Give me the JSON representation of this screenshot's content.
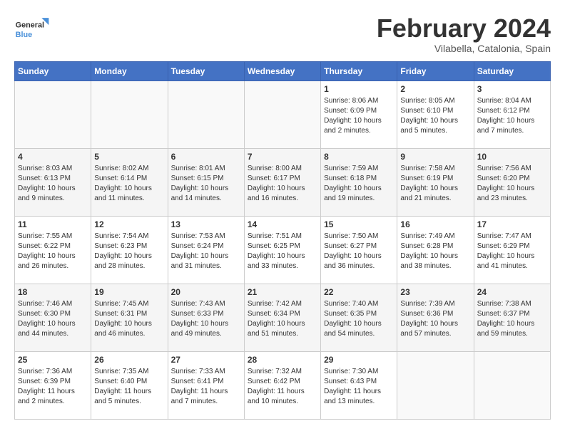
{
  "logo": {
    "text_general": "General",
    "text_blue": "Blue"
  },
  "title": "February 2024",
  "subtitle": "Vilabella, Catalonia, Spain",
  "weekdays": [
    "Sunday",
    "Monday",
    "Tuesday",
    "Wednesday",
    "Thursday",
    "Friday",
    "Saturday"
  ],
  "weeks": [
    [
      {
        "day": "",
        "empty": true
      },
      {
        "day": "",
        "empty": true
      },
      {
        "day": "",
        "empty": true
      },
      {
        "day": "",
        "empty": true
      },
      {
        "day": "1",
        "sunrise": "8:06 AM",
        "sunset": "6:09 PM",
        "daylight": "10 hours and 2 minutes."
      },
      {
        "day": "2",
        "sunrise": "8:05 AM",
        "sunset": "6:10 PM",
        "daylight": "10 hours and 5 minutes."
      },
      {
        "day": "3",
        "sunrise": "8:04 AM",
        "sunset": "6:12 PM",
        "daylight": "10 hours and 7 minutes."
      }
    ],
    [
      {
        "day": "4",
        "sunrise": "8:03 AM",
        "sunset": "6:13 PM",
        "daylight": "10 hours and 9 minutes."
      },
      {
        "day": "5",
        "sunrise": "8:02 AM",
        "sunset": "6:14 PM",
        "daylight": "10 hours and 11 minutes."
      },
      {
        "day": "6",
        "sunrise": "8:01 AM",
        "sunset": "6:15 PM",
        "daylight": "10 hours and 14 minutes."
      },
      {
        "day": "7",
        "sunrise": "8:00 AM",
        "sunset": "6:17 PM",
        "daylight": "10 hours and 16 minutes."
      },
      {
        "day": "8",
        "sunrise": "7:59 AM",
        "sunset": "6:18 PM",
        "daylight": "10 hours and 19 minutes."
      },
      {
        "day": "9",
        "sunrise": "7:58 AM",
        "sunset": "6:19 PM",
        "daylight": "10 hours and 21 minutes."
      },
      {
        "day": "10",
        "sunrise": "7:56 AM",
        "sunset": "6:20 PM",
        "daylight": "10 hours and 23 minutes."
      }
    ],
    [
      {
        "day": "11",
        "sunrise": "7:55 AM",
        "sunset": "6:22 PM",
        "daylight": "10 hours and 26 minutes."
      },
      {
        "day": "12",
        "sunrise": "7:54 AM",
        "sunset": "6:23 PM",
        "daylight": "10 hours and 28 minutes."
      },
      {
        "day": "13",
        "sunrise": "7:53 AM",
        "sunset": "6:24 PM",
        "daylight": "10 hours and 31 minutes."
      },
      {
        "day": "14",
        "sunrise": "7:51 AM",
        "sunset": "6:25 PM",
        "daylight": "10 hours and 33 minutes."
      },
      {
        "day": "15",
        "sunrise": "7:50 AM",
        "sunset": "6:27 PM",
        "daylight": "10 hours and 36 minutes."
      },
      {
        "day": "16",
        "sunrise": "7:49 AM",
        "sunset": "6:28 PM",
        "daylight": "10 hours and 38 minutes."
      },
      {
        "day": "17",
        "sunrise": "7:47 AM",
        "sunset": "6:29 PM",
        "daylight": "10 hours and 41 minutes."
      }
    ],
    [
      {
        "day": "18",
        "sunrise": "7:46 AM",
        "sunset": "6:30 PM",
        "daylight": "10 hours and 44 minutes."
      },
      {
        "day": "19",
        "sunrise": "7:45 AM",
        "sunset": "6:31 PM",
        "daylight": "10 hours and 46 minutes."
      },
      {
        "day": "20",
        "sunrise": "7:43 AM",
        "sunset": "6:33 PM",
        "daylight": "10 hours and 49 minutes."
      },
      {
        "day": "21",
        "sunrise": "7:42 AM",
        "sunset": "6:34 PM",
        "daylight": "10 hours and 51 minutes."
      },
      {
        "day": "22",
        "sunrise": "7:40 AM",
        "sunset": "6:35 PM",
        "daylight": "10 hours and 54 minutes."
      },
      {
        "day": "23",
        "sunrise": "7:39 AM",
        "sunset": "6:36 PM",
        "daylight": "10 hours and 57 minutes."
      },
      {
        "day": "24",
        "sunrise": "7:38 AM",
        "sunset": "6:37 PM",
        "daylight": "10 hours and 59 minutes."
      }
    ],
    [
      {
        "day": "25",
        "sunrise": "7:36 AM",
        "sunset": "6:39 PM",
        "daylight": "11 hours and 2 minutes."
      },
      {
        "day": "26",
        "sunrise": "7:35 AM",
        "sunset": "6:40 PM",
        "daylight": "11 hours and 5 minutes."
      },
      {
        "day": "27",
        "sunrise": "7:33 AM",
        "sunset": "6:41 PM",
        "daylight": "11 hours and 7 minutes."
      },
      {
        "day": "28",
        "sunrise": "7:32 AM",
        "sunset": "6:42 PM",
        "daylight": "11 hours and 10 minutes."
      },
      {
        "day": "29",
        "sunrise": "7:30 AM",
        "sunset": "6:43 PM",
        "daylight": "11 hours and 13 minutes."
      },
      {
        "day": "",
        "empty": true
      },
      {
        "day": "",
        "empty": true
      }
    ]
  ],
  "labels": {
    "sunrise": "Sunrise:",
    "sunset": "Sunset:",
    "daylight": "Daylight:"
  }
}
